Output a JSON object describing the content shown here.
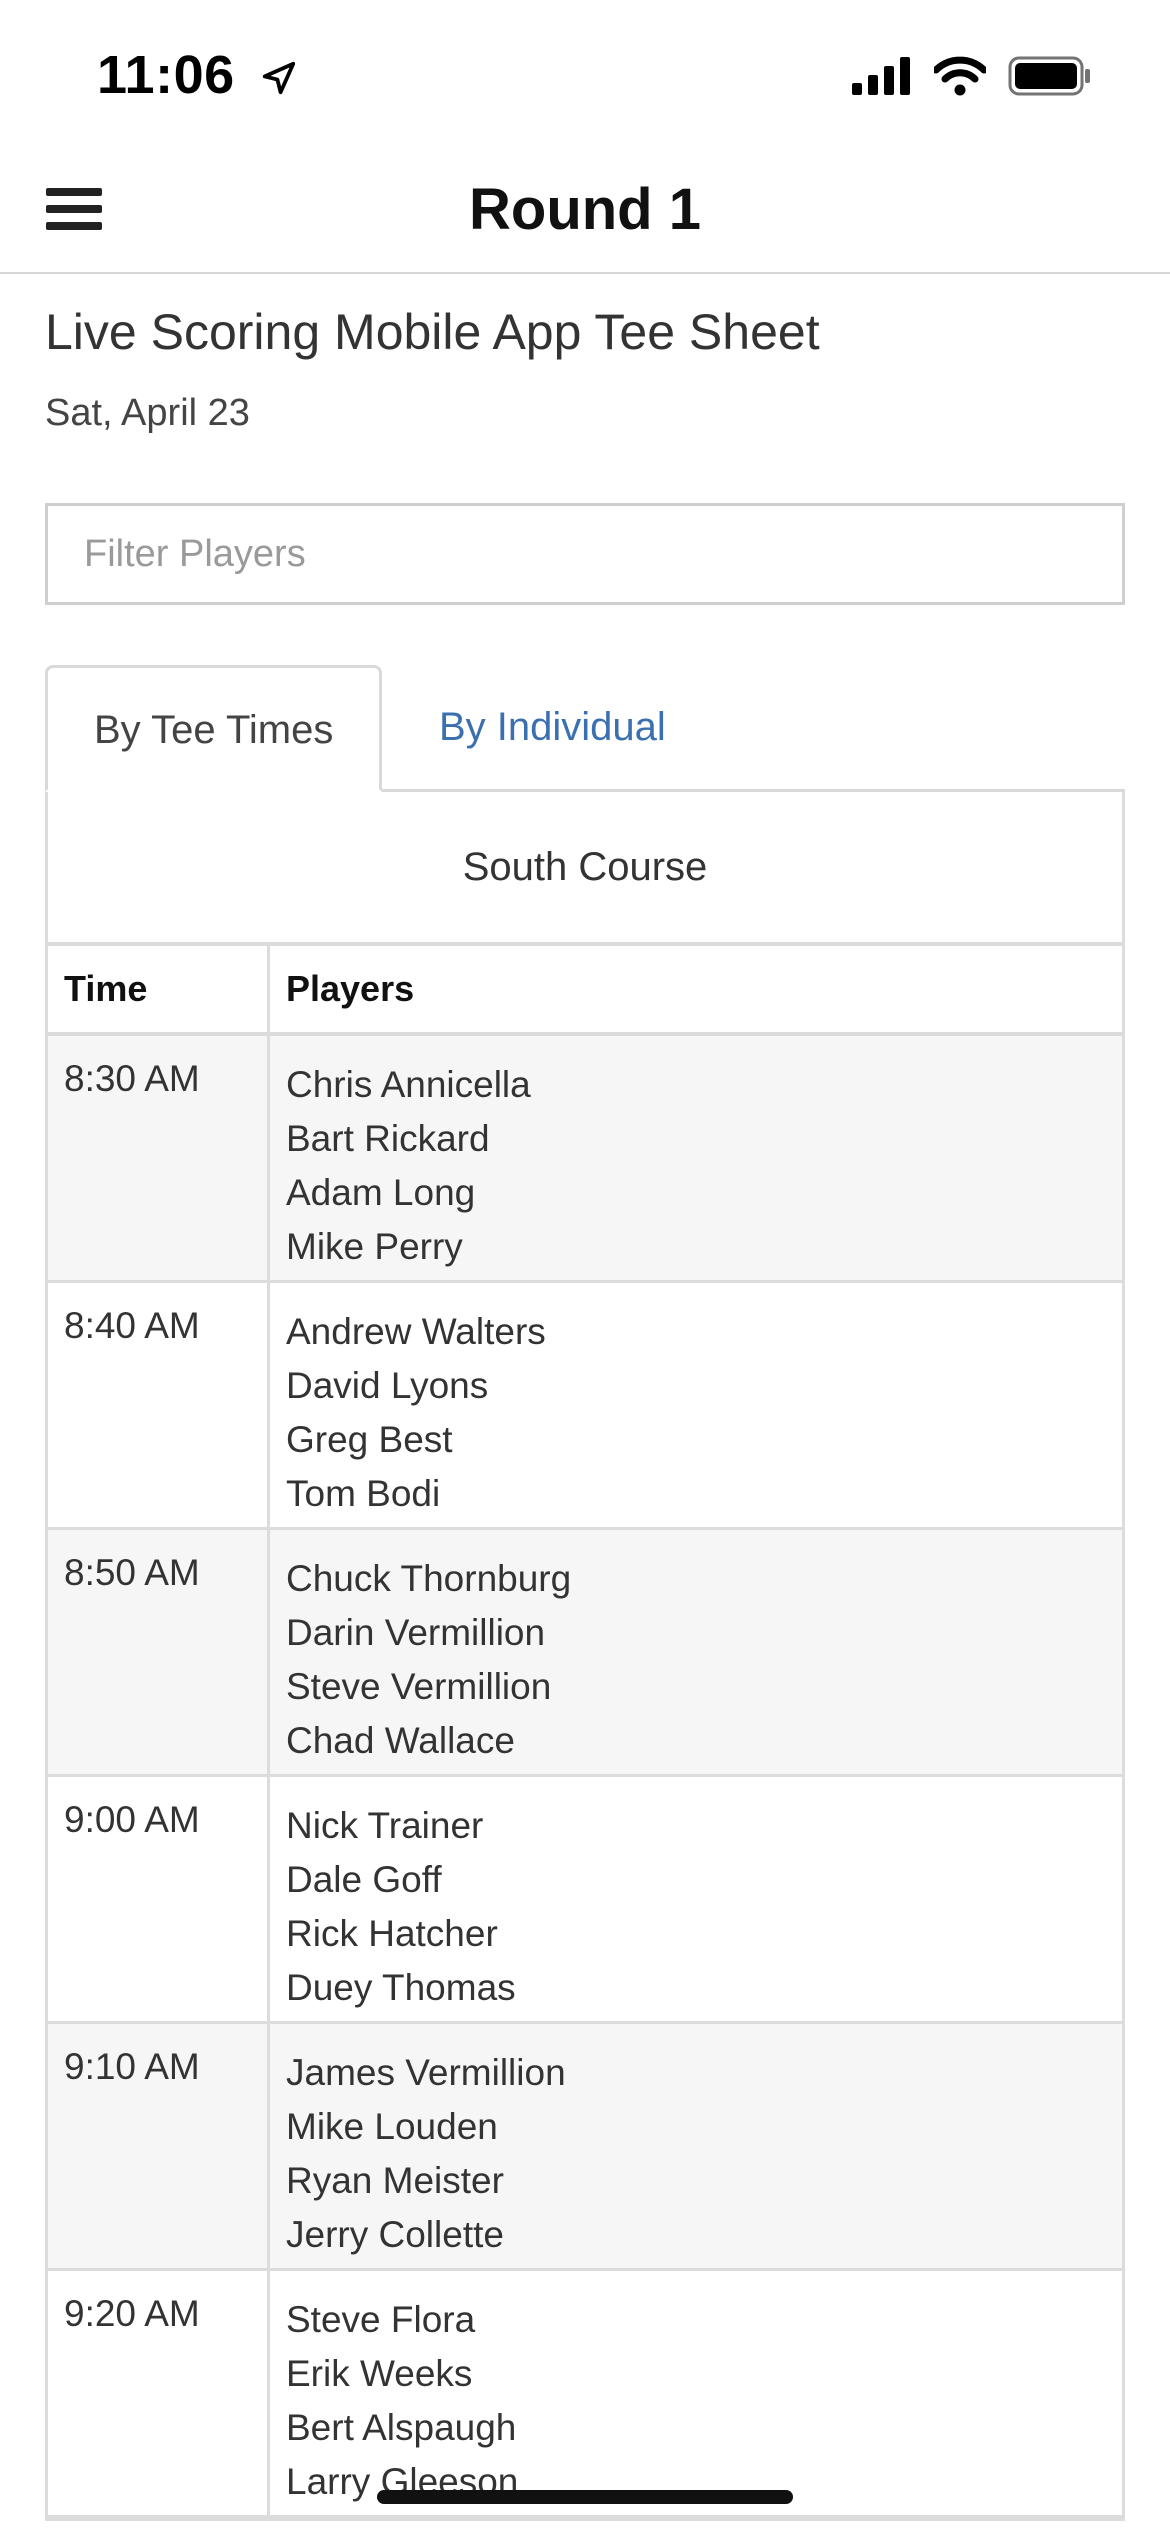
{
  "status_bar": {
    "time": "11:06"
  },
  "header": {
    "title": "Round 1"
  },
  "page": {
    "title": "Live Scoring Mobile App Tee Sheet",
    "date": "Sat, April 23"
  },
  "filter": {
    "placeholder": "Filter Players",
    "value": ""
  },
  "tabs": [
    {
      "label": "By Tee Times",
      "active": true
    },
    {
      "label": "By Individual",
      "active": false
    }
  ],
  "colors": {
    "link": "#3a6fb0",
    "border": "#dcdcdc",
    "row_alt": "#f6f6f6"
  },
  "table": {
    "course": "South Course",
    "headers": {
      "time": "Time",
      "players": "Players"
    },
    "rows": [
      {
        "time": "8:30 AM",
        "players": [
          "Chris Annicella",
          "Bart Rickard",
          "Adam Long",
          "Mike Perry"
        ]
      },
      {
        "time": "8:40 AM",
        "players": [
          "Andrew Walters",
          "David Lyons",
          "Greg Best",
          "Tom Bodi"
        ]
      },
      {
        "time": "8:50 AM",
        "players": [
          "Chuck Thornburg",
          "Darin Vermillion",
          "Steve Vermillion",
          "Chad Wallace"
        ]
      },
      {
        "time": "9:00 AM",
        "players": [
          "Nick Trainer",
          "Dale Goff",
          "Rick Hatcher",
          "Duey Thomas"
        ]
      },
      {
        "time": "9:10 AM",
        "players": [
          "James Vermillion",
          "Mike Louden",
          "Ryan Meister",
          "Jerry Collette"
        ]
      },
      {
        "time": "9:20 AM",
        "players": [
          "Steve Flora",
          "Erik Weeks",
          "Bert Alspaugh",
          "Larry Gleeson"
        ]
      }
    ]
  }
}
